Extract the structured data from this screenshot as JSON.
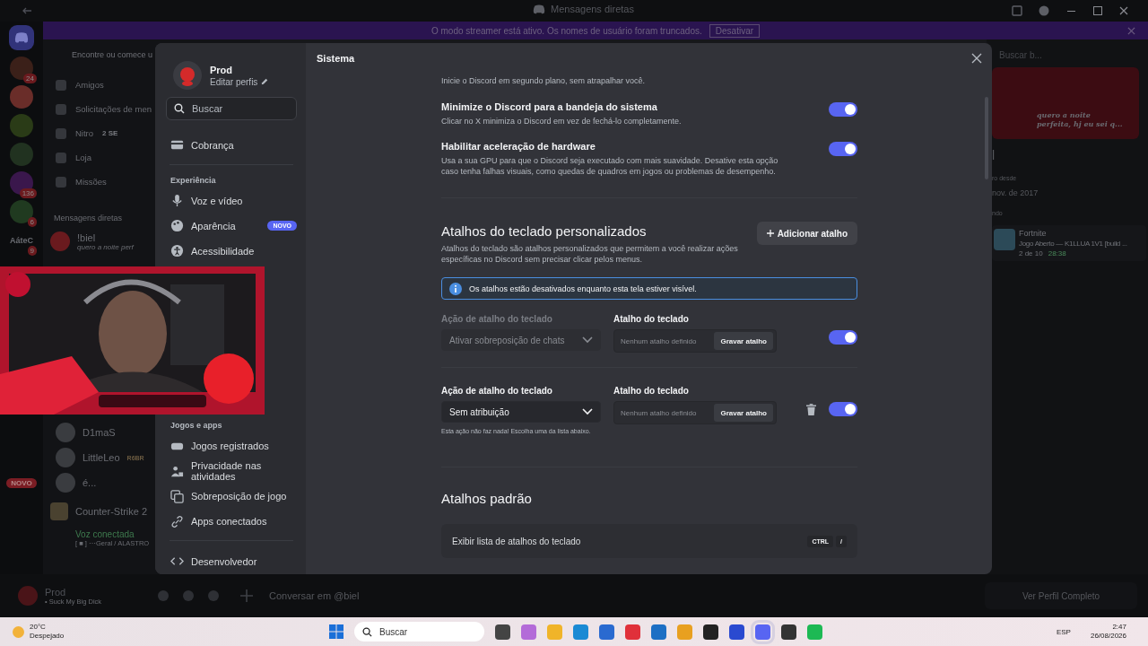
{
  "window": {
    "title": "Mensagens diretas"
  },
  "streamer_banner": {
    "text": "O modo streamer está ativo. Os nomes de usuário foram truncados.",
    "button": "Desativar"
  },
  "server_rail": [
    {
      "color": "#3b2019",
      "badge": "24"
    },
    {
      "color": "#6a2d29"
    },
    {
      "color": "#2a3b17"
    },
    {
      "color": "#213220"
    },
    {
      "color": "#3a174c",
      "badge": "136"
    },
    {
      "color": "#203a20",
      "badge": "6"
    },
    {
      "label": "AáteC",
      "badge": "9"
    }
  ],
  "rail_new_badge": "NOVO",
  "dm_column": {
    "search": {
      "placeholder": "Encontre ou comece u"
    },
    "nav": [
      {
        "label": "Amigos"
      },
      {
        "label": "Solicitações de men"
      },
      {
        "label": "Nitro",
        "badge": "2 SE"
      },
      {
        "label": "Loja"
      },
      {
        "label": "Missões"
      }
    ],
    "heading": "Mensagens diretas",
    "top_dms": [
      {
        "name": "!biel",
        "status": "quero a noite perf"
      }
    ],
    "dms": [
      {
        "name": "D1maS"
      },
      {
        "name": "LittleLeo",
        "tag": "R6BR"
      },
      {
        "name": "é..."
      }
    ],
    "activity": "Counter-Strike 2",
    "voice": {
      "title": "Voz conectada",
      "channel": "[ ■ ] ⋯Geral / ALASTRO"
    }
  },
  "user_panel": {
    "name": "Prod",
    "status": "• Suck My Big Dick"
  },
  "chat_input": {
    "placeholder": "Conversar em @biel"
  },
  "profile_panel": {
    "search": "Buscar b...",
    "bubble": "quero a noite perfeita, hj eu sei q...",
    "name": "l",
    "member_label": "ro desde",
    "member_since": "nov. de 2017",
    "activity_label": "ndo",
    "game": "Fortnite",
    "game_detail": "Jogo Aberto — K1LLUA 1V1 [build ...",
    "party": "2 de 10",
    "elapsed": "28:38",
    "button": "Ver Perfil Completo"
  },
  "settings": {
    "profile": {
      "name": "Prod",
      "subtitle": "Editar perfis"
    },
    "search": {
      "placeholder": "Buscar"
    },
    "sections": [
      {
        "items": [
          {
            "label": "Cobrança"
          }
        ]
      },
      {
        "heading": "Experiência",
        "items": [
          {
            "label": "Voz e vídeo"
          },
          {
            "label": "Aparência",
            "badge": "NOVO"
          },
          {
            "label": "Acessibilidade"
          }
        ]
      },
      {
        "heading": "Jogos e apps",
        "items": [
          {
            "label": "Jogos registrados"
          },
          {
            "label": "Privacidade nas atividades"
          },
          {
            "label": "Sobreposição de jogo"
          },
          {
            "label": "Apps conectados"
          }
        ]
      },
      {
        "items": [
          {
            "label": "Desenvolvedor"
          }
        ]
      }
    ],
    "page_title": "Sistema",
    "intro": "Inicie o Discord em segundo plano, sem atrapalhar você.",
    "toggles": [
      {
        "title": "Minimize o Discord para a bandeja do sistema",
        "description": "Clicar no X minimiza o Discord em vez de fechá-lo completamente.",
        "on": true
      },
      {
        "title": "Habilitar aceleração de hardware",
        "description": "Usa a sua GPU para que o Discord seja executado com mais suavidade. Desative esta opção caso tenha falhas visuais, como quedas de quadros em jogos ou problemas de desempenho.",
        "on": true
      }
    ],
    "custom_shortcuts": {
      "title": "Atalhos do teclado personalizados",
      "description": "Atalhos do teclado são atalhos personalizados que permitem a você realizar ações específicas no Discord sem precisar clicar pelos menus.",
      "add_button": "Adicionar atalho",
      "notice": "Os atalhos estão desativados enquanto esta tela estiver visível.",
      "rows": [
        {
          "action_label": "Ação de atalho do teclado",
          "action": "Ativar sobreposição de chats",
          "shortcut_label": "Atalho do teclado",
          "shortcut_placeholder": "Nenhum atalho definido",
          "record_button": "Gravar atalho",
          "disabled": true,
          "deletable": false,
          "on": true
        },
        {
          "action_label": "Ação de atalho do teclado",
          "action": "Sem atribuição",
          "shortcut_label": "Atalho do teclado",
          "shortcut_placeholder": "Nenhum atalho definido",
          "record_button": "Gravar atalho",
          "disabled": false,
          "deletable": true,
          "on": true,
          "hint": "Esta ação não faz nada! Escolha uma da lista abaixo."
        }
      ]
    },
    "default_shortcuts": {
      "title": "Atalhos padrão",
      "rows": [
        {
          "label": "Exibir lista de atalhos do teclado",
          "keys": [
            "CTRL",
            "/"
          ]
        }
      ]
    }
  },
  "taskbar": {
    "weather": {
      "temp": "20°C",
      "condition": "Despejado"
    },
    "search": {
      "placeholder": "Buscar"
    },
    "apps": [
      {
        "color": "#444444",
        "selected": false
      },
      {
        "color": "#b36bd8",
        "selected": false
      },
      {
        "color": "#f0b429",
        "selected": false
      },
      {
        "color": "#1a8ad4",
        "selected": false
      },
      {
        "color": "#2a6ad0",
        "selected": false
      },
      {
        "color": "#e0303a",
        "selected": false
      },
      {
        "color": "#1d6fc4",
        "selected": false
      },
      {
        "color": "#e8a020",
        "selected": false
      },
      {
        "color": "#222222",
        "selected": false
      },
      {
        "color": "#2a4ad0",
        "selected": false
      },
      {
        "color": "#5865f2",
        "selected": true
      },
      {
        "color": "#333333",
        "selected": false
      },
      {
        "color": "#1db954",
        "selected": false
      }
    ],
    "language": "ESP",
    "time": "2:47",
    "date": "26/08/2026"
  }
}
